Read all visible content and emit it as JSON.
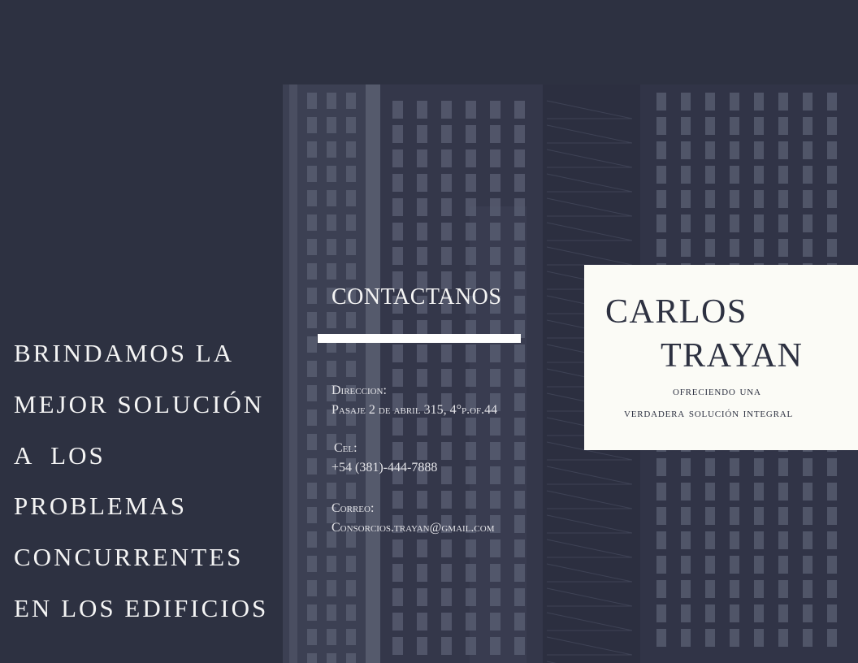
{
  "tagline": {
    "lines": [
      "BRINDAMOS LA",
      "MEJOR SOLUCIÓN",
      "A  LOS",
      "PROBLEMAS",
      "CONCURRENTES",
      "EN LOS EDIFICIOS"
    ]
  },
  "contact": {
    "title": "CONTACTANOS",
    "address_label": "Direccion:",
    "address_value": "Pasaje 2 de abril 315, 4°p.of.44",
    "phone_label": "Cel:",
    "phone_value": "+54 (381)-444-7888",
    "email_label": "Correo:",
    "email_value": "Consorcios.trayan@gmail.com"
  },
  "card": {
    "name_first": "CARLOS",
    "name_last": "TRAYAN",
    "subtitle_line1": "ofreciendo una",
    "subtitle_line2": "verdadera solución integral"
  },
  "colors": {
    "background": "#2d3141",
    "card": "#fbfbf6",
    "text_light": "#f4f4f4",
    "text_dark": "#2d3141"
  },
  "image": {
    "icon": "building-photo"
  }
}
